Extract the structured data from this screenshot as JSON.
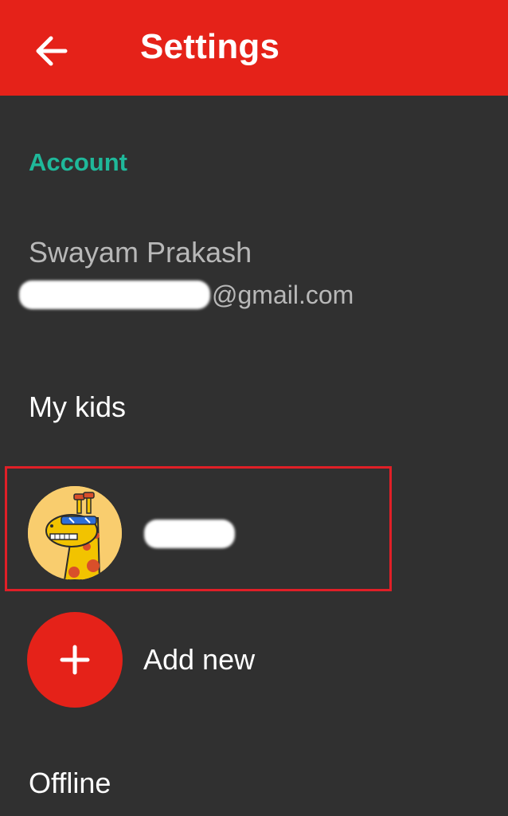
{
  "header": {
    "title": "Settings",
    "back_icon": "arrow-left-icon"
  },
  "account": {
    "section_label": "Account",
    "name": "Swayam Prakash",
    "email_visible_suffix": "@gmail.com"
  },
  "kids": {
    "section_label": "My kids",
    "items": [
      {
        "avatar_icon": "giraffe-avatar"
      }
    ],
    "add_label": "Add new",
    "add_icon": "plus-icon"
  },
  "offline": {
    "label": "Offline"
  },
  "colors": {
    "app_bar": "#e52219",
    "background": "#303030",
    "accent": "#1fb89a",
    "highlight_border": "#e01f27"
  }
}
